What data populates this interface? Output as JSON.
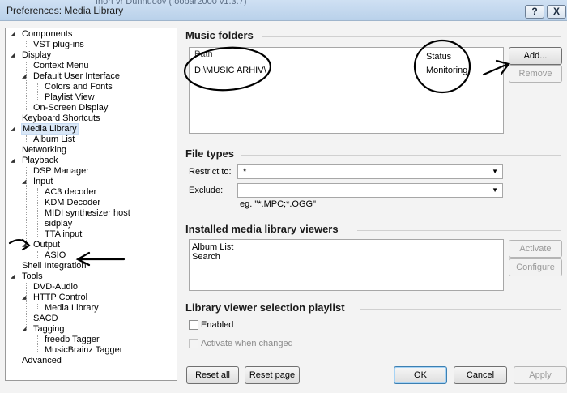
{
  "window": {
    "title": "Preferences: Media Library",
    "behind_text": "fnort vr Dunnuoov (foobar2000 v1.3.7)",
    "help_glyph": "?",
    "close_glyph": "X"
  },
  "tree": [
    {
      "label": "Components",
      "expanded": true
    },
    {
      "label": "VST plug-ins"
    },
    {
      "label": "Display",
      "expanded": true
    },
    {
      "label": "Context Menu"
    },
    {
      "label": "Default User Interface",
      "expanded": true
    },
    {
      "label": "Colors and Fonts"
    },
    {
      "label": "Playlist View"
    },
    {
      "label": "On-Screen Display"
    },
    {
      "label": "Keyboard Shortcuts"
    },
    {
      "label": "Media Library",
      "expanded": true,
      "selected": true
    },
    {
      "label": "Album List"
    },
    {
      "label": "Networking"
    },
    {
      "label": "Playback",
      "expanded": true
    },
    {
      "label": "DSP Manager"
    },
    {
      "label": "Input",
      "expanded": true
    },
    {
      "label": "AC3 decoder"
    },
    {
      "label": "KDM Decoder"
    },
    {
      "label": "MIDI synthesizer host"
    },
    {
      "label": "sidplay"
    },
    {
      "label": "TTA input"
    },
    {
      "label": "Output",
      "expanded": true
    },
    {
      "label": "ASIO"
    },
    {
      "label": "Shell Integration"
    },
    {
      "label": "Tools",
      "expanded": true
    },
    {
      "label": "DVD-Audio"
    },
    {
      "label": "HTTP Control",
      "expanded": true
    },
    {
      "label": "Media Library"
    },
    {
      "label": "SACD"
    },
    {
      "label": "Tagging",
      "expanded": true
    },
    {
      "label": "freedb Tagger"
    },
    {
      "label": "MusicBrainz Tagger"
    },
    {
      "label": "Advanced"
    }
  ],
  "music_folders": {
    "title": "Music folders",
    "columns": [
      "Path",
      "Status"
    ],
    "rows": [
      {
        "path": "D:\\MUSIC ARHIV\\",
        "status": "Monitoring"
      }
    ],
    "add_label": "Add...",
    "remove_label": "Remove"
  },
  "file_types": {
    "title": "File types",
    "restrict_label": "Restrict to:",
    "restrict_value": "*",
    "exclude_label": "Exclude:",
    "exclude_value": "",
    "hint": "eg. \"*.MPC;*.OGG\""
  },
  "viewers": {
    "title": "Installed media library viewers",
    "items": [
      "Album List",
      "Search"
    ],
    "activate_label": "Activate",
    "configure_label": "Configure"
  },
  "playlist": {
    "title": "Library viewer selection playlist",
    "enabled_label": "Enabled",
    "enabled_checked": false,
    "activate_when_changed_label": "Activate when changed"
  },
  "footer": {
    "reset_all": "Reset all",
    "reset_page": "Reset page",
    "ok": "OK",
    "cancel": "Cancel",
    "apply": "Apply"
  },
  "colors": {
    "accent": "#3c7fb1",
    "selection": "#d9e7f7",
    "annotation": "#000000"
  }
}
